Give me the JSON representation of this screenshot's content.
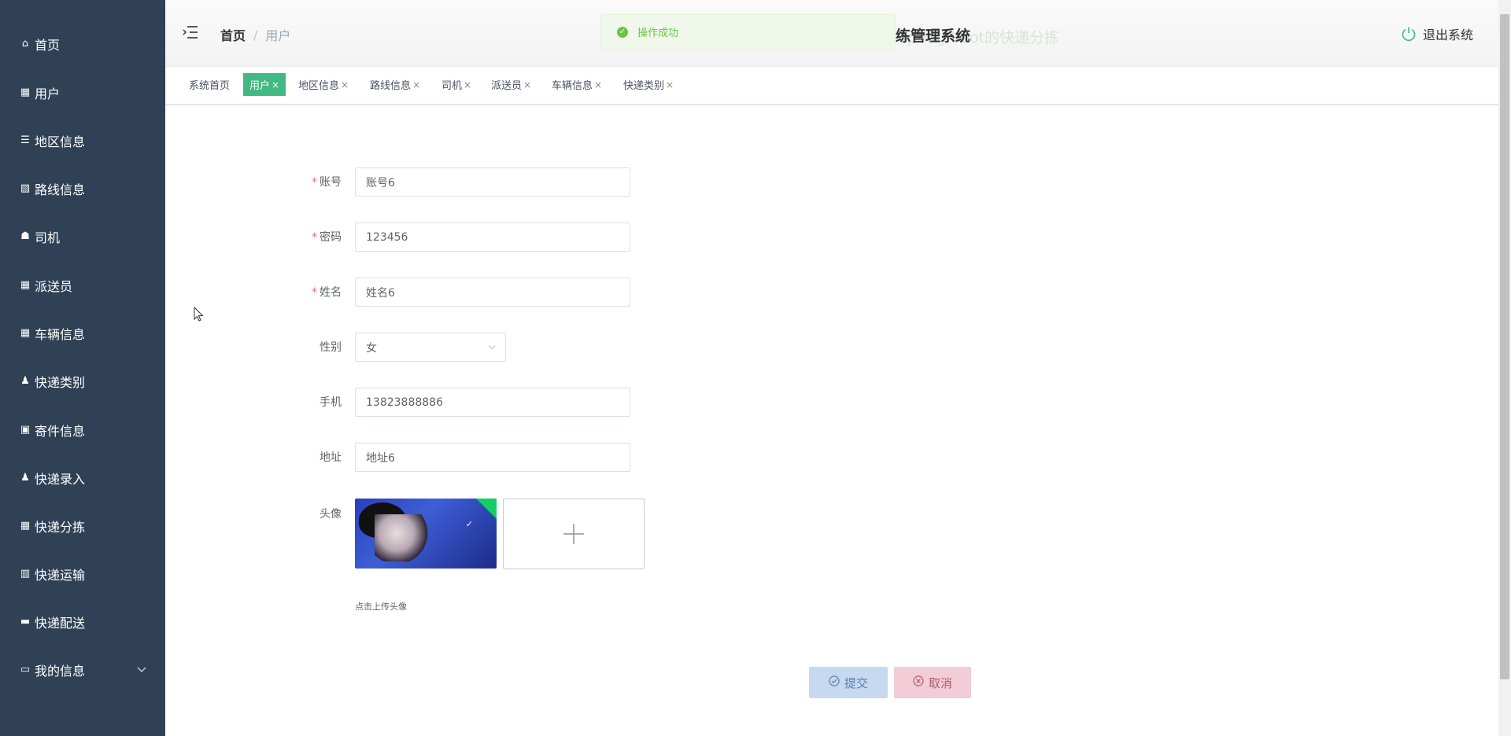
{
  "sidebar": {
    "items": [
      {
        "label": "首页",
        "icon": "home-icon",
        "glyph": "⌂"
      },
      {
        "label": "用户",
        "icon": "grid-icon",
        "glyph": "▦"
      },
      {
        "label": "地区信息",
        "icon": "list-icon",
        "glyph": "☰"
      },
      {
        "label": "路线信息",
        "icon": "chart-icon",
        "glyph": "▨"
      },
      {
        "label": "司机",
        "icon": "thumb-icon",
        "glyph": "☗"
      },
      {
        "label": "派送员",
        "icon": "grid-icon",
        "glyph": "▦"
      },
      {
        "label": "车辆信息",
        "icon": "grid-icon",
        "glyph": "▦"
      },
      {
        "label": "快递类别",
        "icon": "user-icon",
        "glyph": "♟"
      },
      {
        "label": "寄件信息",
        "icon": "clipboard-icon",
        "glyph": "▣"
      },
      {
        "label": "快递录入",
        "icon": "user-icon",
        "glyph": "♟"
      },
      {
        "label": "快递分拣",
        "icon": "grid-icon",
        "glyph": "▦"
      },
      {
        "label": "快递运输",
        "icon": "bar-chart-icon",
        "glyph": "▥"
      },
      {
        "label": "快递配送",
        "icon": "ticket-icon",
        "glyph": "▬"
      },
      {
        "label": "我的信息",
        "icon": "card-icon",
        "glyph": "▭",
        "expandable": true
      }
    ]
  },
  "header": {
    "breadcrumb_home": "首页",
    "breadcrumb_sep": "/",
    "breadcrumb_current": "用户",
    "title": "练管理系统",
    "title_ghost": "基于spring boot的快递分拣",
    "logout_label": "退出系统"
  },
  "toast": {
    "message": "操作成功",
    "type": "success"
  },
  "tags": [
    {
      "label": "系统首页",
      "closable": false,
      "active": false
    },
    {
      "label": "用户",
      "closable": true,
      "active": true
    },
    {
      "label": "地区信息",
      "closable": true,
      "active": false
    },
    {
      "label": "路线信息",
      "closable": true,
      "active": false
    },
    {
      "label": "司机",
      "closable": true,
      "active": false
    },
    {
      "label": "派送员",
      "closable": true,
      "active": false
    },
    {
      "label": "车辆信息",
      "closable": true,
      "active": false
    },
    {
      "label": "快递类别",
      "closable": true,
      "active": false
    }
  ],
  "tag_close_glyph": "×",
  "form": {
    "account": {
      "label": "账号",
      "value": "账号6",
      "required": true
    },
    "password": {
      "label": "密码",
      "value": "123456",
      "required": true
    },
    "name": {
      "label": "姓名",
      "value": "姓名6",
      "required": true
    },
    "gender": {
      "label": "性别",
      "value": "女"
    },
    "phone": {
      "label": "手机",
      "value": "13823888886"
    },
    "address": {
      "label": "地址",
      "value": "地址6"
    },
    "avatar": {
      "label": "头像",
      "tip": "点击上传头像"
    },
    "required_mark": "*"
  },
  "buttons": {
    "submit": "提交",
    "cancel": "取消"
  },
  "colors": {
    "sidebar_bg": "#304156",
    "tag_active": "#42b983",
    "toast_success": "#67c23a",
    "required": "#f56c6c"
  }
}
